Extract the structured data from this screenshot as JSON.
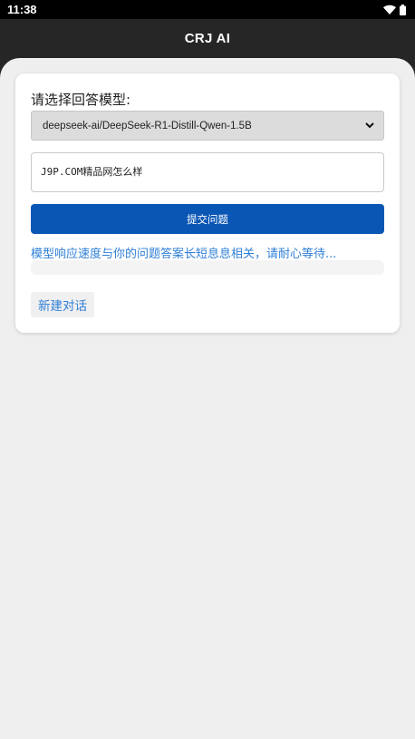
{
  "status_bar": {
    "time": "11:38",
    "icons": [
      "wifi-icon",
      "battery-icon"
    ]
  },
  "app_bar": {
    "title": "CRJ AI"
  },
  "form": {
    "model_label": "请选择回答模型:",
    "model_selected": "deepseek-ai/DeepSeek-R1-Distill-Qwen-1.5B",
    "question_value": "J9P.COM精品网怎么样",
    "submit_label": "提交问题",
    "wait_hint": "模型响应速度与你的问题答案长短息息相关，请耐心等待...",
    "response_text": "",
    "new_chat_label": "新建对话"
  },
  "colors": {
    "status_bar": "#000000",
    "app_bar": "#262626",
    "background": "#efefef",
    "card": "#ffffff",
    "primary_button": "#0a56b5",
    "link_text": "#2f7fd6",
    "select_bg": "#dcdcdc"
  }
}
